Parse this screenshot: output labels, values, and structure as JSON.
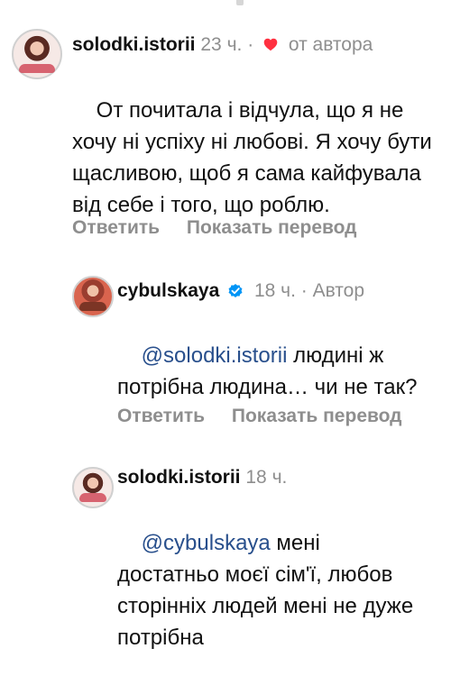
{
  "comments": [
    {
      "username": "solodki.istorii",
      "time": "23 ч.",
      "dot": "·",
      "author_like_label": "от автора",
      "text_before_mention": "",
      "mention": "",
      "text": "От почитала і відчула, що я не хочу ні успіху ні любові. Я хочу бути щасливою, щоб я сама кайфувала від себе і того, що роблю.",
      "reply_label": "Ответить",
      "translate_label": "Показать перевод"
    },
    {
      "username": "cybulskaya",
      "verified": true,
      "time": "18 ч.",
      "dot": "·",
      "author_label": "Автор",
      "mention": "@solodki.istorii",
      "text": " людині ж потрібна людина… чи не так?",
      "reply_label": "Ответить",
      "translate_label": "Показать перевод"
    },
    {
      "username": "solodki.istorii",
      "time": "18 ч.",
      "mention": "@cybulskaya",
      "text": " мені достатньо моєї сім'ї, любов сторінніх людей мені не дуже потрібна"
    }
  ],
  "icons": {
    "heart": "heart-icon",
    "verified": "verified-badge-icon"
  },
  "colors": {
    "heart": "#ff3040",
    "verified": "#0095f6",
    "mention": "#284f8c",
    "meta": "#8e8e8e"
  }
}
